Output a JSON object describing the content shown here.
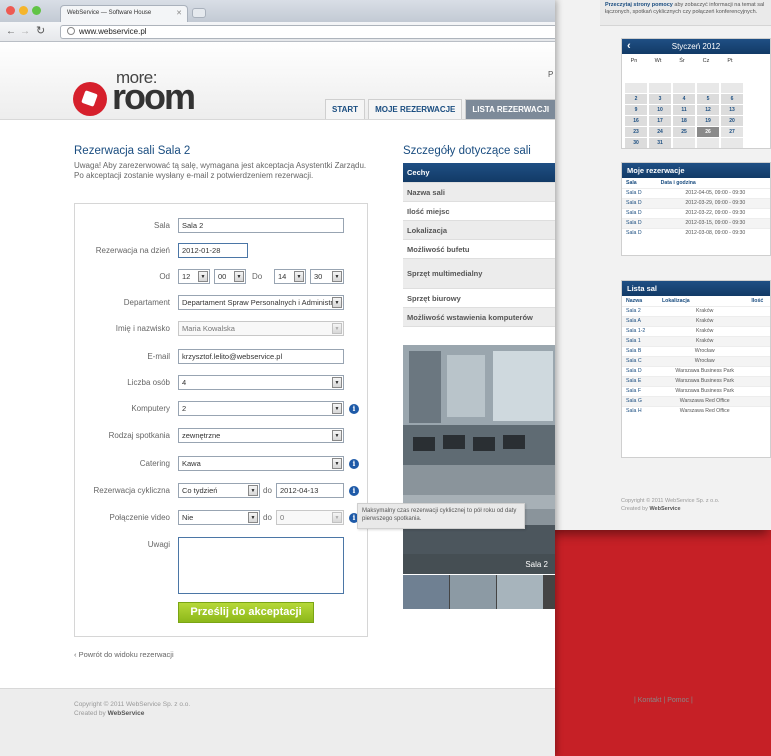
{
  "browser": {
    "tab_title": "WebService — Software House",
    "url": "www.webservice.pl"
  },
  "logo": {
    "small": "more:",
    "big": "room"
  },
  "header": {
    "letter": "P"
  },
  "nav": [
    "START",
    "MOJE REZERWACJE",
    "LISTA REZERWACJI"
  ],
  "page": {
    "title": "Rezerwacja sali Sala 2",
    "intro": "Uwaga! Aby zarezerwować tą salę, wymagana jest akceptacja Asystentki Zarządu. Po akceptacji zostanie wysłany e-mail z potwierdzeniem rezerwacji.",
    "back_link": "‹  Powrót do widoku rezerwacji"
  },
  "form": {
    "sala_label": "Sala",
    "sala_value": "Sala 2",
    "date_label": "Rezerwacja na dzień",
    "date_value": "2012-01-28",
    "od_label": "Od",
    "od_hour": "12",
    "od_min": "00",
    "do_label": "Do",
    "do_hour": "14",
    "do_min": "30",
    "dept_label": "Departament",
    "dept_value": "Departament Spraw Personalnych i Administracji",
    "name_label": "Imię i nazwisko",
    "name_value": "Maria Kowalska",
    "email_label": "E-mail",
    "email_value": "krzysztof.lelito@webservice.pl",
    "people_label": "Liczba osób",
    "people_value": "4",
    "computers_label": "Komputery",
    "computers_value": "2",
    "meeting_label": "Rodzaj spotkania",
    "meeting_value": "zewnętrzne",
    "catering_label": "Catering",
    "catering_value": "Kawa",
    "cyclic_label": "Rezerwacja cykliczna",
    "cyclic_value": "Co tydzień",
    "cyclic_to_label": "do",
    "cyclic_to_value": "2012-04-13",
    "video_label": "Połączenie video",
    "video_value": "Nie",
    "video_to_label": "do",
    "video_to_value": "0",
    "notes_label": "Uwagi",
    "submit": "Prześlij do akceptacji",
    "tooltip": "Maksymalny czas rezerwacji cyklicznej to pół roku od daty pierwszego spotkania."
  },
  "details": {
    "title": "Szczegóły dotyczące sali",
    "header": "Cechy",
    "rows": [
      "Nazwa sali",
      "Ilość miejsc",
      "Lokalizacja",
      "Możliwość bufetu",
      "Sprzęt multimedialny",
      "Sprzęt biurowy",
      "Możliwość wstawienia komputerów"
    ],
    "photo_caption": "Sala 2"
  },
  "footer": {
    "copyright": "Copyright © 2011 WebService Sp. z o.o.",
    "created_prefix": "Created by",
    "created_by": "WebService",
    "links": [
      "Kontakt",
      "Pomoc"
    ]
  },
  "back_window": {
    "top_bold": "Przeczytaj strony pomocy",
    "top_text": "aby zobaczyć informacji na temat sal łączonych, spotkań cyklicznych czy połączeń konferencyjnych.",
    "calendar": {
      "title": "Styczeń 2012",
      "days": [
        "Pn",
        "Wt",
        "Śr",
        "Cz",
        "Pt"
      ],
      "weeks": [
        [
          "",
          "",
          "",
          "",
          ""
        ],
        [
          "2",
          "3",
          "4",
          "5",
          "6"
        ],
        [
          "9",
          "10",
          "11",
          "12",
          "13"
        ],
        [
          "16",
          "17",
          "18",
          "19",
          "20"
        ],
        [
          "23",
          "24",
          "25",
          "26",
          "27"
        ],
        [
          "30",
          "31",
          "",
          "",
          ""
        ]
      ]
    },
    "my_reservations": {
      "title": "Moje rezerwacje",
      "col_sala": "Sala",
      "col_date": "Data i godzina",
      "rows": [
        [
          "Sala D",
          "2012-04-05, 09:00 - 09:30"
        ],
        [
          "Sala D",
          "2012-03-29, 09:00 - 09:30"
        ],
        [
          "Sala D",
          "2012-03-22, 09:00 - 09:30"
        ],
        [
          "Sala D",
          "2012-03-15, 09:00 - 09:30"
        ],
        [
          "Sala D",
          "2012-03-08, 09:00 - 09:30"
        ]
      ]
    },
    "rooms": {
      "title": "Lista sal",
      "col_name": "Nazwa",
      "col_loc": "Lokalizacja",
      "col_count": "Ilość",
      "rows": [
        [
          "Sala 2",
          "Kraków"
        ],
        [
          "Sala A",
          "Kraków"
        ],
        [
          "Sala 1-2",
          "Kraków"
        ],
        [
          "Sala 1",
          "Kraków"
        ],
        [
          "Sala B",
          "Wrocław"
        ],
        [
          "Sala C",
          "Wrocław"
        ],
        [
          "Sala D",
          "Warszawa Business Park"
        ],
        [
          "Sala E",
          "Warszawa Business Park"
        ],
        [
          "Sala F",
          "Warszawa Business Park"
        ],
        [
          "Sala G",
          "Warszawa Red Office"
        ],
        [
          "Sala H",
          "Warszawa Red Office"
        ]
      ]
    },
    "footer_copyright": "Copyright © 2011 WebService Sp. z o.o.",
    "footer_created_prefix": "Created by",
    "footer_created_by": "WebService"
  },
  "colors": {
    "brand_red": "#c62026",
    "nav_blue": "#1a4d80",
    "submit_green": "#a2c82c",
    "info_blue": "#1e5aa8"
  }
}
